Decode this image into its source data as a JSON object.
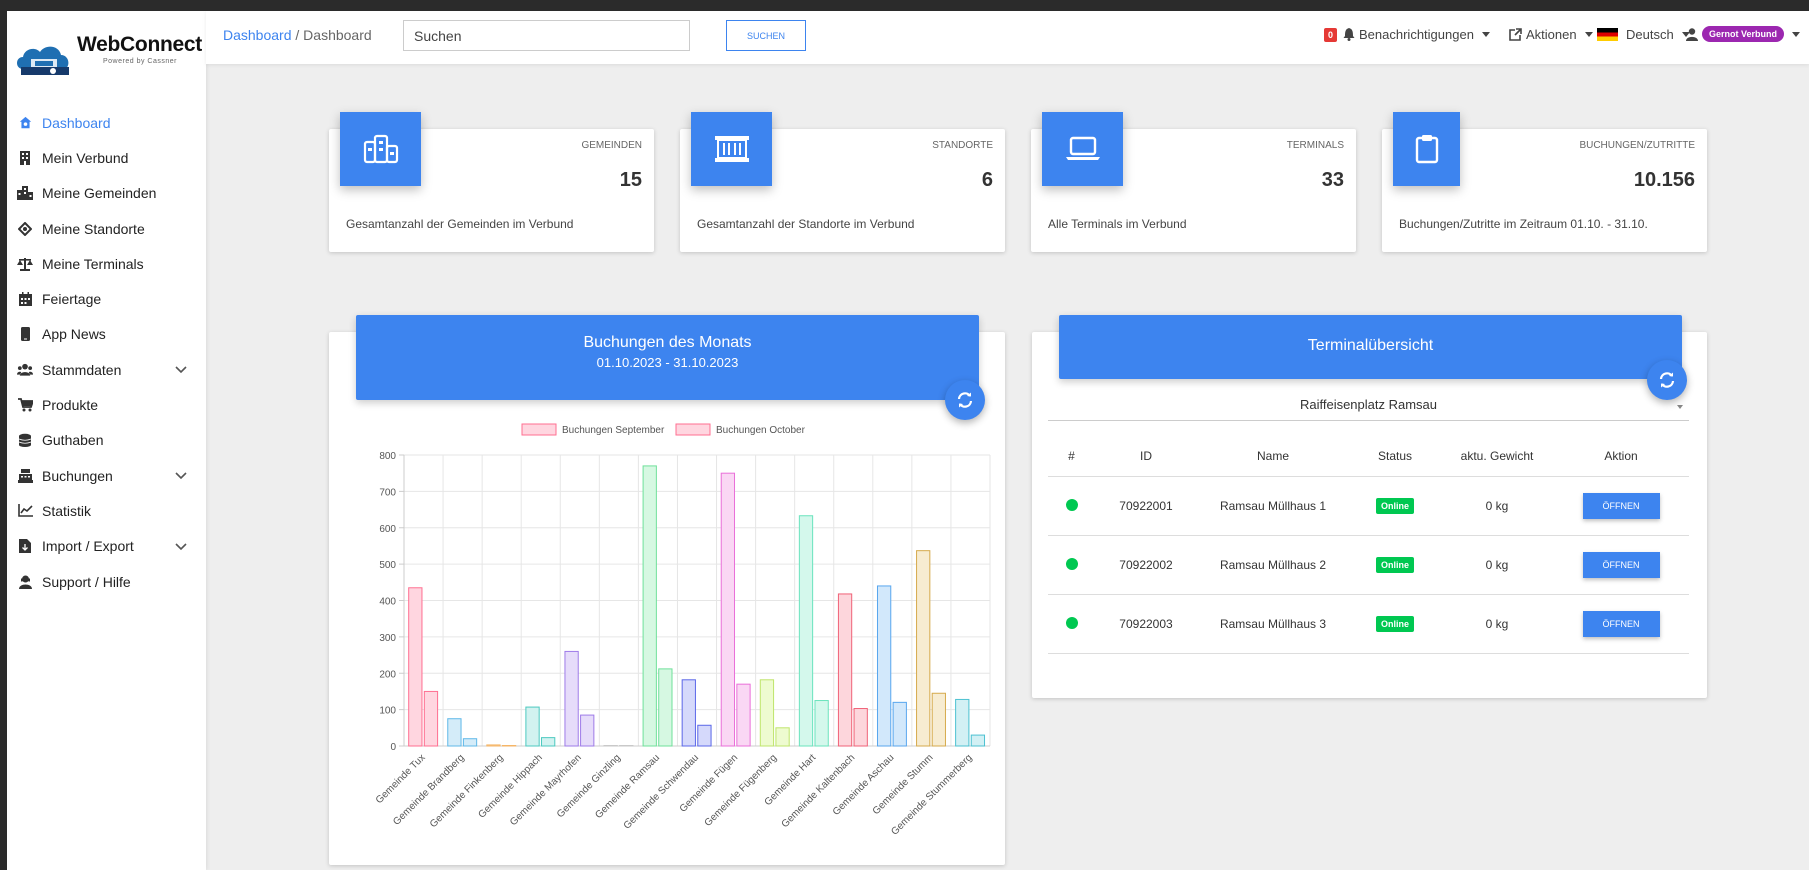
{
  "app": {
    "brand": "WebConnect",
    "brand_sub": "Powered by Cassner"
  },
  "sidebar": {
    "items": [
      {
        "label": "Dashboard",
        "icon": "dashboard-icon",
        "active": true
      },
      {
        "label": "Mein Verbund",
        "icon": "building-icon"
      },
      {
        "label": "Meine Gemeinden",
        "icon": "city-icon"
      },
      {
        "label": "Meine Standorte",
        "icon": "location-icon"
      },
      {
        "label": "Meine Terminals",
        "icon": "scale-icon"
      },
      {
        "label": "Feiertage",
        "icon": "calendar-icon"
      },
      {
        "label": "App News",
        "icon": "mobile-icon"
      },
      {
        "label": "Stammdaten",
        "icon": "users-icon",
        "expandable": true
      },
      {
        "label": "Produkte",
        "icon": "cart-icon"
      },
      {
        "label": "Guthaben",
        "icon": "coins-icon"
      },
      {
        "label": "Buchungen",
        "icon": "register-icon",
        "expandable": true
      },
      {
        "label": "Statistik",
        "icon": "chart-line-icon"
      },
      {
        "label": "Import / Export",
        "icon": "file-import-icon",
        "expandable": true
      },
      {
        "label": "Support / Hilfe",
        "icon": "support-icon"
      }
    ]
  },
  "topbar": {
    "breadcrumb_link": "Dashboard",
    "breadcrumb_sep": " / ",
    "breadcrumb_current": "Dashboard",
    "search_placeholder": "Suchen",
    "search_button": "SUCHEN",
    "notification_count": "0",
    "notifications": "Benachrichtigungen",
    "actions": "Aktionen",
    "language": "Deutsch",
    "user": "Gernot Verbund"
  },
  "stats": [
    {
      "label": "GEMEINDEN",
      "value": "15",
      "desc": "Gesamtanzahl der Gemeinden im Verbund",
      "icon": "city-icon"
    },
    {
      "label": "STANDORTE",
      "value": "6",
      "desc": "Gesamtanzahl der Standorte im Verbund",
      "icon": "container-icon"
    },
    {
      "label": "TERMINALS",
      "value": "33",
      "desc": "Alle Terminals im Verbund",
      "icon": "laptop-icon"
    },
    {
      "label": "BUCHUNGEN/ZUTRITTE",
      "value": "10.156",
      "desc": "Buchungen/Zutritte im Zeitraum 01.10. - 31.10.",
      "icon": "clipboard-icon"
    }
  ],
  "bookings_panel": {
    "title": "Buchungen des Monats",
    "subtitle": "01.10.2023 - 31.10.2023"
  },
  "terminal_panel": {
    "title": "Terminalübersicht",
    "location": "Raiffeisenplatz Ramsau",
    "columns": [
      "#",
      "ID",
      "Name",
      "Status",
      "aktu. Gewicht",
      "Aktion"
    ],
    "rows": [
      {
        "id": "70922001",
        "name": "Ramsau Müllhaus 1",
        "status": "Online",
        "weight": "0 kg",
        "action": "ÖFFNEN"
      },
      {
        "id": "70922002",
        "name": "Ramsau Müllhaus 2",
        "status": "Online",
        "weight": "0 kg",
        "action": "ÖFFNEN"
      },
      {
        "id": "70922003",
        "name": "Ramsau Müllhaus 3",
        "status": "Online",
        "weight": "0 kg",
        "action": "ÖFFNEN"
      }
    ]
  },
  "chart_data": {
    "type": "bar",
    "categories": [
      "Gemeinde Tux",
      "Gemeinde Brandberg",
      "Gemeinde Finkenberg",
      "Gemeinde Hippach",
      "Gemeinde Mayrhofen",
      "Gemeinde Ginzling",
      "Gemeinde Ramsau",
      "Gemeinde Schwendau",
      "Gemeinde Fügen",
      "Gemeinde Fügenberg",
      "Gemeinde Hart",
      "Gemeinde Kaltenbach",
      "Gemeinde Aschau",
      "Gemeinde Stumm",
      "Gemeinde Stummerberg"
    ],
    "series": [
      {
        "name": "Buchungen September",
        "values": [
          435,
          75,
          3,
          107,
          260,
          0,
          770,
          182,
          750,
          182,
          633,
          418,
          440,
          537,
          128
        ]
      },
      {
        "name": "Buchungen October",
        "values": [
          150,
          20,
          0,
          23,
          85,
          0,
          212,
          57,
          170,
          50,
          125,
          103,
          120,
          145,
          30
        ]
      }
    ],
    "ylim": [
      0,
      800
    ],
    "yticks": [
      0,
      100,
      200,
      300,
      400,
      500,
      600,
      700,
      800
    ],
    "grid": true,
    "legend": "top",
    "colors": [
      {
        "fill": "#ffd6e0",
        "stroke": "#ff6f91"
      },
      {
        "fill": "#d4ecf9",
        "stroke": "#5fb8e8"
      },
      {
        "fill": "#fde7c8",
        "stroke": "#f5b668"
      },
      {
        "fill": "#d2f2f0",
        "stroke": "#4cc9c0"
      },
      {
        "fill": "#e6dcfa",
        "stroke": "#9e7be8"
      },
      {
        "fill": "#f2f2f2",
        "stroke": "#c9c9c9"
      },
      {
        "fill": "#d6f8e2",
        "stroke": "#6fe09a"
      },
      {
        "fill": "#d5d9fb",
        "stroke": "#5b67e8"
      },
      {
        "fill": "#fad7f4",
        "stroke": "#ea6fd9"
      },
      {
        "fill": "#eefbd0",
        "stroke": "#bfe56b"
      },
      {
        "fill": "#d4f8ec",
        "stroke": "#6ae3bd"
      },
      {
        "fill": "#fdd6dc",
        "stroke": "#f06277"
      },
      {
        "fill": "#d2e8fb",
        "stroke": "#58a6ee"
      },
      {
        "fill": "#f7ecd1",
        "stroke": "#d6aa4c"
      },
      {
        "fill": "#d2f0f4",
        "stroke": "#4cc1d1"
      }
    ]
  }
}
